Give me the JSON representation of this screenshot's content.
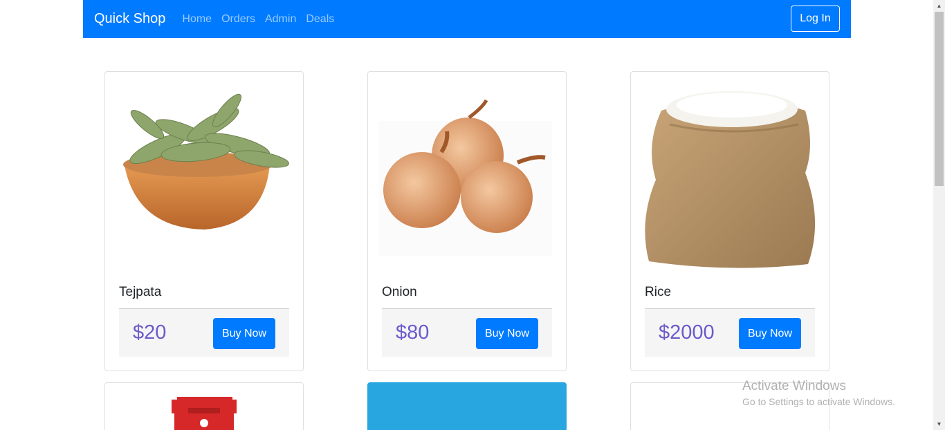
{
  "navbar": {
    "brand": "Quick Shop",
    "links": [
      "Home",
      "Orders",
      "Admin",
      "Deals"
    ],
    "login_label": "Log In"
  },
  "products": [
    {
      "name": "Tejpata",
      "price": "$20",
      "button": "Buy Now",
      "image": "bay-leaves-bowl"
    },
    {
      "name": "Onion",
      "price": "$80",
      "button": "Buy Now",
      "image": "onions"
    },
    {
      "name": "Rice",
      "price": "$2000",
      "button": "Buy Now",
      "image": "rice-sack"
    }
  ],
  "watermark": {
    "title": "Activate Windows",
    "subtitle": "Go to Settings to activate Windows."
  },
  "colors": {
    "primary": "#007bff",
    "price": "#6a5acd",
    "card_blue": "#27a6e0"
  }
}
